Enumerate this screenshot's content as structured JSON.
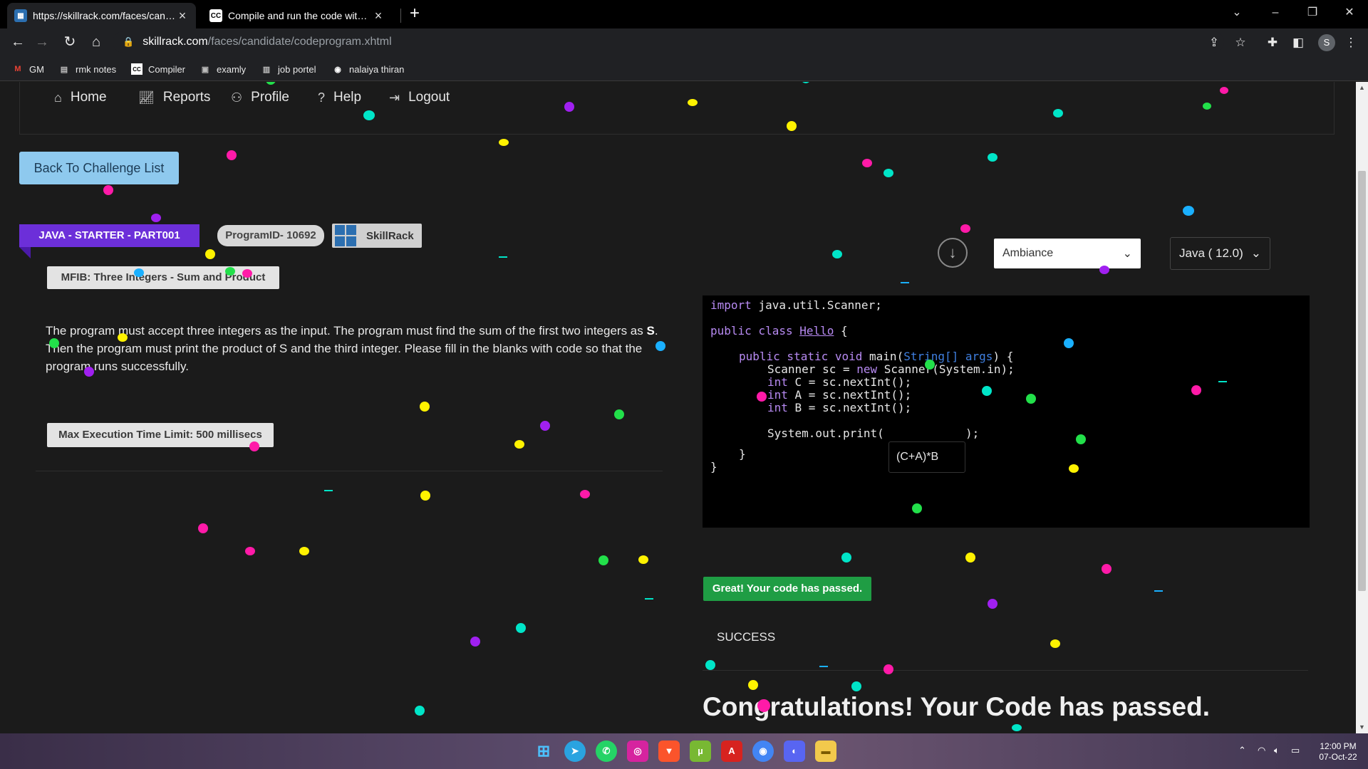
{
  "browser": {
    "tabs": [
      {
        "title": "https://skillrack.com/faces/candidate/codeprogram.xhtml",
        "active": true
      },
      {
        "title": "Compile and run the code with online compiler",
        "active": false
      }
    ],
    "url_host": "skillrack.com",
    "url_path": "/faces/candidate/codeprogram.xhtml",
    "profile_initial": "S",
    "bookmarks": [
      "GM",
      "rmk notes",
      "Compiler",
      "examly",
      "job portel",
      "nalaiya thiran"
    ]
  },
  "nav": {
    "home": "Home",
    "reports": "Reports",
    "profile": "Profile",
    "help": "Help",
    "logout": "Logout"
  },
  "back_button": "Back To Challenge List",
  "course_banner": "JAVA - STARTER - PART001",
  "program_id": "ProgramID- 10692",
  "skillrack_badge": "SkillRack",
  "problem_title": "MFIB: Three Integers - Sum and Product",
  "description": {
    "part1": "The program must accept three integers as the input. The program must find the sum of the first two integers as ",
    "bold": "S",
    "part2": ". Then the program must print the product of S and the third integer. Please fill in the blanks with code so that the program runs successfully."
  },
  "time_limit": "Max Execution Time Limit: 500 millisecs",
  "editor": {
    "theme": "Ambiance",
    "language": "Java ( 12.0)",
    "blank_value": "(C+A)*B",
    "code": {
      "l1a": "import ",
      "l1b": "java.util.Scanner;",
      "l2a": "public class ",
      "l2b": "Hello",
      "l2c": " {",
      "l3a": "public static void ",
      "l3b": "main(",
      "l3c": "String[] args",
      "l3d": ") {",
      "l4a": "Scanner sc = ",
      "l4b": "new ",
      "l4c": "Scanner(System.in);",
      "l5a": "int ",
      "l5b": "C = sc.nextInt();",
      "l6a": "int ",
      "l6b": "A = sc.nextInt();",
      "l7a": "int ",
      "l7b": "B = sc.nextInt();",
      "l8a": "System.out.print(",
      "l8b": ");",
      "l9": "}",
      "l10": "}"
    }
  },
  "result": {
    "badge": "Great! Your code has passed.",
    "status": "SUCCESS",
    "congrats": "Congratulations! Your Code has passed."
  },
  "taskbar": {
    "time": "12:00 PM",
    "date": "07-Oct-22",
    "apps": [
      "start-icon",
      "telegram-icon",
      "whatsapp-icon",
      "instagram-icon",
      "brave-icon",
      "utorrent-icon",
      "pdf-icon",
      "chrome-icon",
      "discord-icon",
      "file-explorer-icon"
    ]
  },
  "colors": {
    "page_bg": "#1b1b1b",
    "banner": "#6c2fd9",
    "success": "#1f9d44",
    "back_button": "#8ec9ee",
    "confetti": [
      "#ff1aa8",
      "#00e5c8",
      "#fff200",
      "#a020f0",
      "#22e04a",
      "#1ab0ff"
    ]
  }
}
